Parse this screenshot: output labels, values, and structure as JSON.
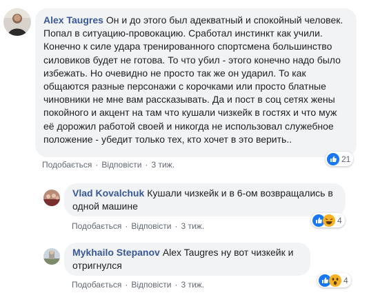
{
  "comments": [
    {
      "author": "Alex Taugres",
      "text": "Он и до этого был адекватный и спокойный человек. Попал в ситуацию-провокацию. Сработал инстинкт как учили. Конечно к силе удара тренированного спортсмена большинство силовиков будет не готова. То что убил - этого конечно надо было избежать. Но очевидно не просто так же он ударил. То как общаются разные персонажи с корочками или просто блатные чиновники не мне вам рассказывать. Да и пост в соц сетях жены покойного и акцент на там что кушали чизкейк в гостях и что муж её дорожил работой своей и никогда не использовал служебное положение - убедит только тех, кто хочет в это верить..",
      "like_label": "Подобається",
      "reply_label": "Відповісти",
      "time": "3 тиж.",
      "reaction_count": "21"
    },
    {
      "author": "Vlad Kovalchuk",
      "text": "Кушали чизкейк и в 6-ом возвращались в одной машине",
      "like_label": "Подобається",
      "reply_label": "Відповісти",
      "time": "3 тиж.",
      "reaction_count": "4"
    },
    {
      "author": "Mykhailo Stepanov",
      "mention": "Alex Taugres",
      "text": "ну вот чизкейк и отригнулся",
      "like_label": "Подобається",
      "reply_label": "Відповісти",
      "time": "3 тиж.",
      "reaction_count": "4"
    }
  ],
  "separator": "·",
  "colors": {
    "author": "#385898",
    "bubble": "#f2f3f5",
    "meta": "#606770",
    "like_blue": "#1877f2",
    "haha_yellow": "#f7b125"
  },
  "icons": [
    "like-reaction-icon",
    "haha-reaction-icon",
    "wow-reaction-icon"
  ]
}
